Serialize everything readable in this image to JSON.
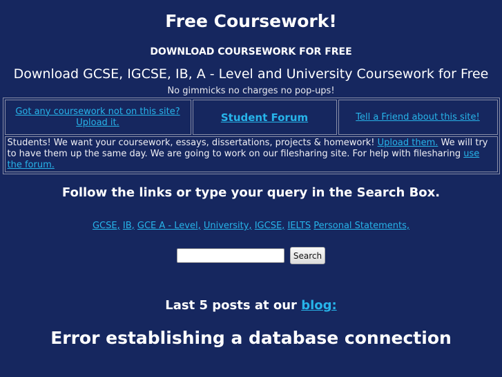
{
  "header": {
    "title": "Free Coursework!",
    "subtitle": "DOWNLOAD COURSEWORK FOR FREE",
    "tagline": "Download GCSE, IGCSE, IB, A - Level and University Coursework for Free",
    "note": "No gimmicks no charges no pop-ups!"
  },
  "nav": {
    "upload_line1": "Got any coursework not on this site?",
    "upload_line2": "Upload it.",
    "forum": "Student Forum",
    "tell_friend": "Tell a Friend about this site!"
  },
  "notice": {
    "text1": "Students! We want your coursework, essays, dissertations, projects & homework! ",
    "upload_link": "Upload them.",
    "text2": " We will try to have them up the same day. We are going to work on our filesharing site. For help with filesharing ",
    "forum_link": "use the forum."
  },
  "follow": "Follow the links or type your query in the Search Box.",
  "categories": [
    "GCSE,",
    "IB,",
    "GCE A - Level,",
    "University,",
    "IGCSE,",
    "IELTS",
    "Personal Statements,"
  ],
  "search": {
    "value": "",
    "button": "Search"
  },
  "blog": {
    "prefix": "Last 5 posts at our ",
    "link": "blog:"
  },
  "error": "Error establishing a database connection",
  "colors": {
    "background": "#16275f",
    "link": "#27b4ea",
    "text": "#ffffff"
  }
}
